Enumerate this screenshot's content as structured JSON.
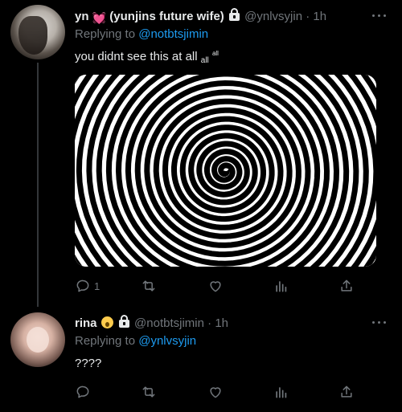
{
  "tweets": [
    {
      "display_name": "yn",
      "name_suffix": "(yunjins future wife)",
      "handle": "@ynlvsyjin",
      "time": "1h",
      "replying_prefix": "Replying to",
      "replying_handle": "@notbtsjimin",
      "text_main": "you didnt see this at all",
      "text_small_1": "all",
      "text_small_2": "all",
      "reply_count": "1",
      "media": "spiral-image",
      "icons": [
        "heart-emoji",
        "lock-icon",
        "more-icon",
        "reply-icon",
        "retweet-icon",
        "like-icon",
        "views-icon",
        "share-icon"
      ]
    },
    {
      "display_name": "rina",
      "handle": "@notbtsjimin",
      "time": "1h",
      "replying_prefix": "Replying to",
      "replying_handle": "@ynlvsyjin",
      "text_main": "????",
      "reply_count": "",
      "icons": [
        "scream-emoji",
        "lock-icon",
        "more-icon",
        "reply-icon",
        "retweet-icon",
        "like-icon",
        "views-icon",
        "share-icon"
      ]
    }
  ],
  "separator": "·",
  "colors": {
    "background": "#000000",
    "text": "#e7e9ea",
    "muted": "#71767b",
    "link": "#1d9bf0",
    "thread_line": "#333639"
  }
}
